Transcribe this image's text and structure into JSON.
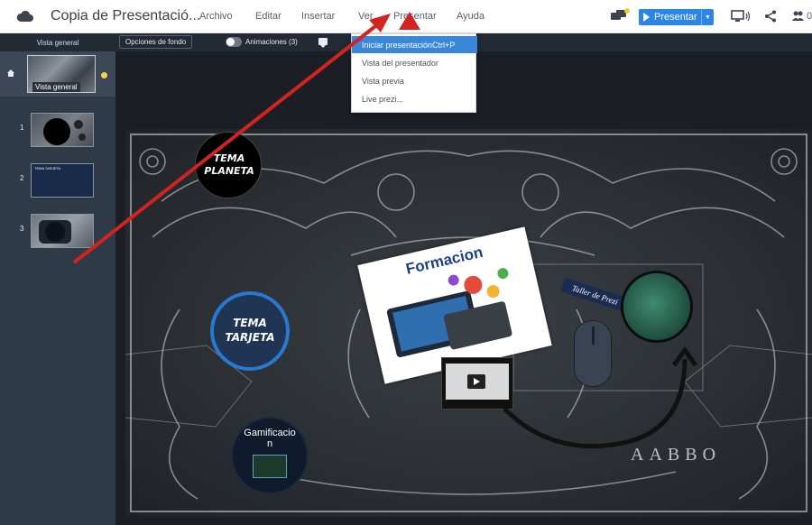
{
  "app": {
    "doc_title": "Copia de Presentació...",
    "colors": {
      "accent": "#2b86e8",
      "dark_toolbar": "#242a33",
      "sidebar": "#2f3a48",
      "annotation_arrow": "#d2231f"
    }
  },
  "menu": {
    "items": [
      "Archivo",
      "Editar",
      "Insertar",
      "Ver",
      "Presentar",
      "Ayuda"
    ]
  },
  "header_right": {
    "present_label": "Presentar",
    "icons": [
      "comments-icon",
      "present-screen-icon",
      "share-icon",
      "collaborators-icon"
    ],
    "collab_count": "0"
  },
  "toolbar": {
    "overview_label": "Vista general",
    "background_label": "Opciones de fondo",
    "animations_label": "Animaciones (3)"
  },
  "sidebar": {
    "overview_label": "Vista general",
    "slides": [
      {
        "number": "1"
      },
      {
        "number": "2",
        "thumb_text": "TEMA TARJETA"
      },
      {
        "number": "3"
      }
    ]
  },
  "dropdown": {
    "items": [
      {
        "label": "Iniciar presentación",
        "shortcut": "Ctrl+P",
        "active": true
      },
      {
        "label": "Vista del presentador",
        "active": false
      },
      {
        "label": "Vista previa",
        "active": false
      },
      {
        "label": "Live prezi...",
        "active": false
      }
    ]
  },
  "canvas": {
    "topic_planeta": [
      "TEMA",
      "PLANETA"
    ],
    "topic_tarjeta": [
      "TEMA",
      "TARJETA"
    ],
    "gamificacion": [
      "Gamificacio",
      "n"
    ],
    "formacion": "Formacion",
    "taller": "Taller de Prezi",
    "banner_letters": "AABBO"
  }
}
